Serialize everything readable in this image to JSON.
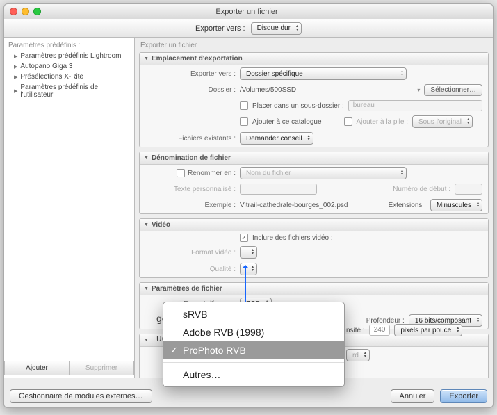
{
  "window": {
    "title": "Exporter un fichier"
  },
  "topbar": {
    "label": "Exporter vers :",
    "value": "Disque dur"
  },
  "sidebar": {
    "header": "Paramètres prédéfinis :",
    "items": [
      {
        "label": "Paramètres prédéfinis Lightroom"
      },
      {
        "label": "Autopano Giga 3"
      },
      {
        "label": "Présélections X-Rite"
      },
      {
        "label": "Paramètres prédéfinis de l'utilisateur"
      }
    ],
    "buttons": {
      "add": "Ajouter",
      "remove": "Supprimer"
    }
  },
  "main": {
    "header": "Exporter un fichier",
    "panels": {
      "export_location": {
        "title": "Emplacement d'exportation",
        "exporter_vers_label": "Exporter vers :",
        "exporter_vers_value": "Dossier spécifique",
        "dossier_label": "Dossier :",
        "dossier_value": "/Volumes/500SSD",
        "select_button": "Sélectionner…",
        "subfolder_check": "Placer dans un sous-dossier :",
        "subfolder_value": "bureau",
        "add_catalog_check": "Ajouter à ce catalogue",
        "add_stack_check": "Ajouter à la pile :",
        "add_stack_value": "Sous l'original",
        "existing_label": "Fichiers existants :",
        "existing_value": "Demander conseil"
      },
      "file_naming": {
        "title": "Dénomination de fichier",
        "rename_check": "Renommer en :",
        "rename_value": "Nom du fichier",
        "custom_text_label": "Texte personnalisé :",
        "start_number_label": "Numéro de début :",
        "example_label": "Exemple :",
        "example_value": "Vitrail-cathedrale-bourges_002.psd",
        "extensions_label": "Extensions :",
        "extensions_value": "Minuscules"
      },
      "video": {
        "title": "Vidéo",
        "include_check": "Inclure des fichiers vidéo :",
        "format_label": "Format vidéo :",
        "quality_label": "Qualité :"
      },
      "file_settings": {
        "title": "Paramètres de fichier",
        "format_label": "Format d'image :",
        "format_value": "PSD",
        "colorspace_label": "Espace colorimétrique :",
        "colorspace_value": "ProPhoto RVB",
        "depth_label": "Profondeur :",
        "depth_value": "16 bits/composant"
      }
    }
  },
  "dropdown": {
    "items": [
      {
        "label": "sRVB",
        "selected": false
      },
      {
        "label": "Adobe RVB (1998)",
        "selected": false
      },
      {
        "label": "ProPhoto RVB",
        "selected": true
      }
    ],
    "other": "Autres…"
  },
  "clip_left": {
    "r1": "ge",
    "r2": "ue"
  },
  "clip_right": {
    "label1": "nsité :",
    "value1": "240",
    "value2": "pixels par pouce",
    "value3": "rd"
  },
  "footer": {
    "plugins": "Gestionnaire de modules externes…",
    "cancel": "Annuler",
    "export": "Exporter"
  }
}
